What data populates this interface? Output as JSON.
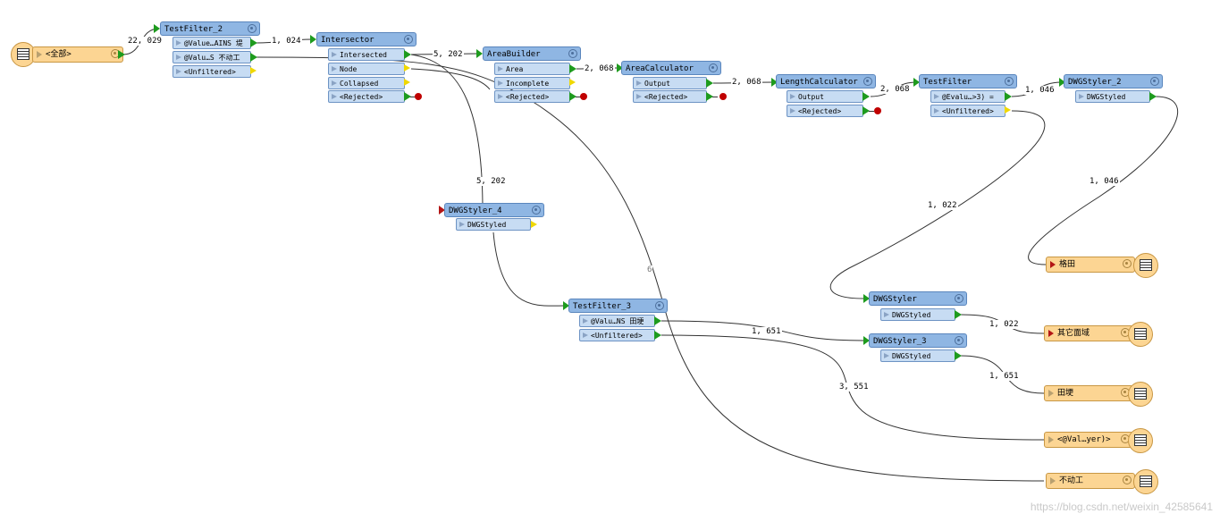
{
  "readers": [
    {
      "id": "all",
      "label": "<全部>"
    }
  ],
  "transformers": {
    "testfilter2": {
      "title": "TestFilter_2",
      "ports": [
        "@Value…AINS 堤",
        "@Valu…S 不动工",
        "<Unfiltered>"
      ]
    },
    "intersector": {
      "title": "Intersector",
      "ports": [
        "Intersected",
        "Node",
        "Collapsed",
        "<Rejected>"
      ]
    },
    "areabuilder": {
      "title": "AreaBuilder",
      "ports": [
        "Area",
        "Incomplete",
        "<Rejected>"
      ]
    },
    "areacalculator": {
      "title": "AreaCalculator",
      "ports": [
        "Output",
        "<Rejected>"
      ]
    },
    "lengthcalculator": {
      "title": "LengthCalculator",
      "ports": [
        "Output",
        "<Rejected>"
      ]
    },
    "testfilter": {
      "title": "TestFilter",
      "ports": [
        "@Evalu…>3) =",
        "<Unfiltered>"
      ]
    },
    "dwgstyler2": {
      "title": "DWGStyler_2",
      "ports": [
        "DWGStyled"
      ]
    },
    "dwgstyler4": {
      "title": "DWGStyler_4",
      "ports": [
        "DWGStyled"
      ]
    },
    "testfilter3": {
      "title": "TestFilter_3",
      "ports": [
        "@Valu…NS 田埂",
        "<Unfiltered>"
      ]
    },
    "dwgstyler": {
      "title": "DWGStyler",
      "ports": [
        "DWGStyled"
      ]
    },
    "dwgstyler3": {
      "title": "DWGStyler_3",
      "ports": [
        "DWGStyled"
      ]
    }
  },
  "writers": [
    {
      "id": "getian",
      "label": "格田"
    },
    {
      "id": "qita",
      "label": "其它面域"
    },
    {
      "id": "tiange",
      "label": "田埂"
    },
    {
      "id": "valyer",
      "label": "<@Val…yer)>"
    },
    {
      "id": "budonggong",
      "label": "不动工"
    }
  ],
  "edge_counts": {
    "e_reader_tf2": "22, 029",
    "e_tf2_int": "1, 024",
    "e_int_ab": "5, 202",
    "e_ab_ac": "2, 068",
    "e_ac_lc": "2, 068",
    "e_lc_tf": "2, 068",
    "e_tf_ds2": "1, 046",
    "e_int_ds4": "5, 202",
    "e_ds2_getian": "1, 046",
    "e_tf_ds": "1, 022",
    "e_ab_budong": "6",
    "e_ds_qita": "1, 022",
    "e_tf3_ds3": "1, 651",
    "e_ds3_tiange": "1, 651",
    "e_tf3_valyer": "3, 551"
  },
  "watermark": "https://blog.csdn.net/weixin_42585641"
}
